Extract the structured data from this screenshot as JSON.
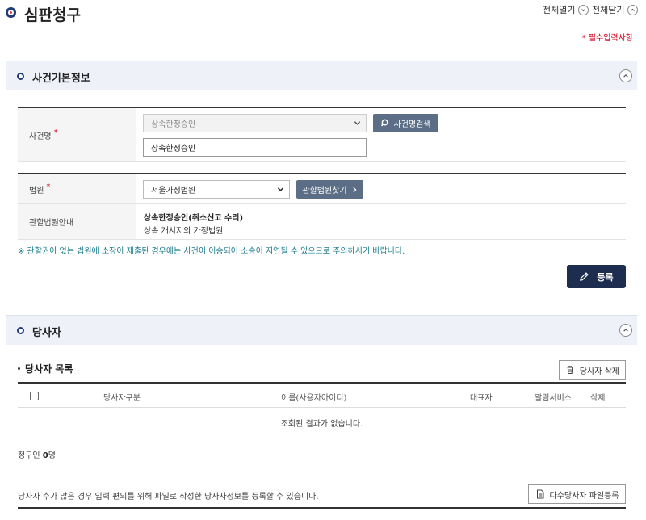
{
  "page": {
    "title": "심판청구",
    "expand_all": "전체열기",
    "collapse_all": "전체닫기",
    "required_note": "* 필수입력사항"
  },
  "case_section": {
    "title": "사건기본정보",
    "case_name_label": "사건명",
    "case_name_select": "상속한정승인",
    "case_name_input": "상속한정승인",
    "case_search_button": "사건명검색",
    "court_label": "법원",
    "court_select": "서울가정법원",
    "court_find_button": "관할법원찾기",
    "jurisdiction_label": "관할법원안내",
    "jurisdiction_line1": "상속한정승인(취소신고 수리)",
    "jurisdiction_line2": "상속 개시지의 가정법원",
    "notice": "※ 관할권이 없는 법원에 소장이 제출된 경우에는 사건이 이송되어 소송이 지연될 수 있으므로 주의하시기 바랍니다.",
    "register_button": "등록"
  },
  "party_section": {
    "title": "당사자",
    "list_title": "당사자 목록",
    "delete_button": "당사자 삭제",
    "columns": [
      "당사자구분",
      "이름(사용자아이디)",
      "대표자",
      "알림서비스",
      "삭제"
    ],
    "empty_message": "조회된 결과가 없습니다.",
    "count_prefix": "청구인",
    "count_value": "0",
    "count_suffix": "명",
    "bulk_note": "당사자 수가 많은 경우 입력 편의를 위해 파일로 작성한 당사자정보를 등록할 수 있습니다.",
    "bulk_button": "다수당사자 파일등록"
  },
  "icons": {
    "title_bullet": "circle-bullet-icon",
    "search": "search-icon",
    "pencil": "pencil-icon",
    "trash": "trash-icon",
    "file": "file-icon"
  },
  "colors": {
    "navy": "#1d2d4f",
    "button_gray": "#5b6e86",
    "required_red": "#d0021b",
    "notice_teal": "#1a7a8a",
    "section_bg": "#eef2f8"
  }
}
